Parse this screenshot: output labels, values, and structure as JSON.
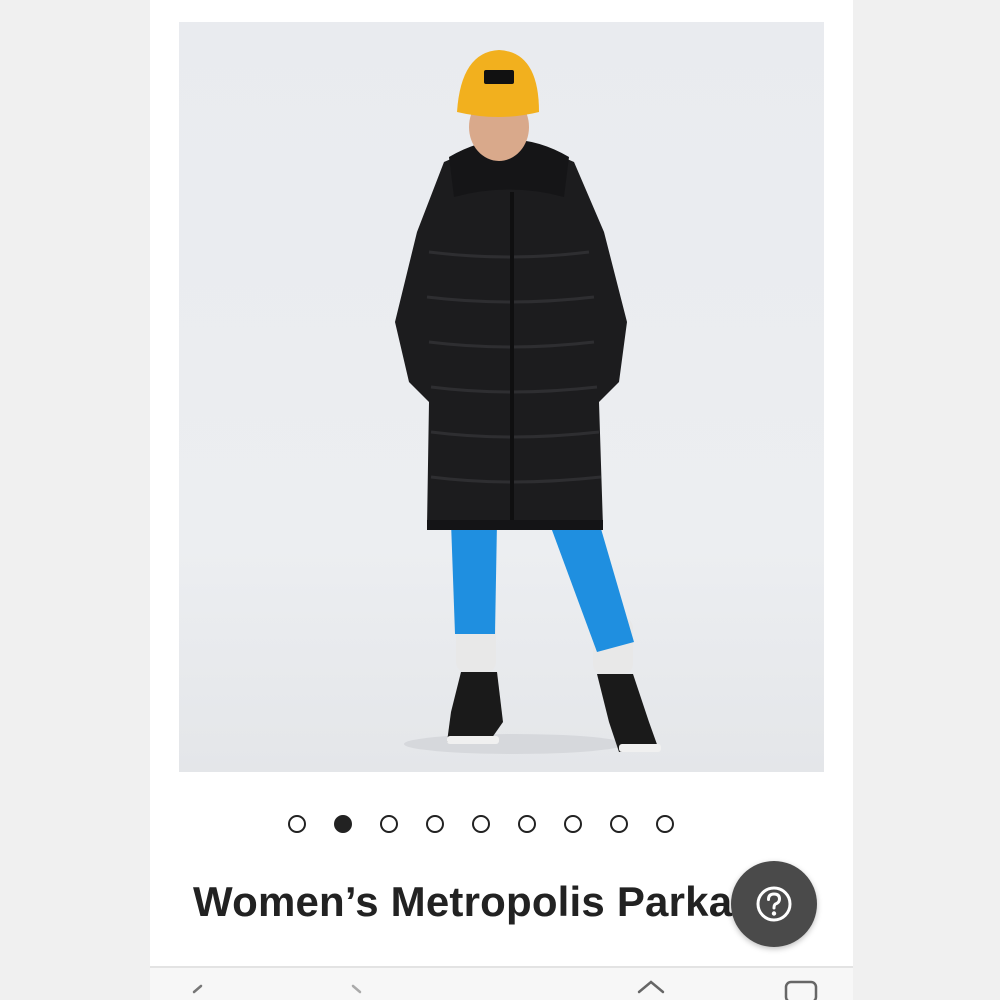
{
  "product": {
    "title": "Women’s Metropolis Parka",
    "image_alt": "product-photo"
  },
  "carousel": {
    "dots": [
      {
        "active": false
      },
      {
        "active": true
      },
      {
        "active": false
      },
      {
        "active": false
      },
      {
        "active": false
      },
      {
        "active": false
      },
      {
        "active": false
      },
      {
        "active": false
      },
      {
        "active": false
      }
    ]
  },
  "help": {
    "icon": "question-circle-icon"
  },
  "bottom_nav": {
    "icons": [
      "back-chevron-icon",
      "forward-chevron-icon",
      "home-icon",
      "tabs-icon"
    ]
  },
  "colors": {
    "title": "#222222",
    "help_bg": "#4a4a4a",
    "jacket": "#1c1c1e",
    "beanie": "#f2b01e",
    "leggings": "#1f8fe0"
  }
}
